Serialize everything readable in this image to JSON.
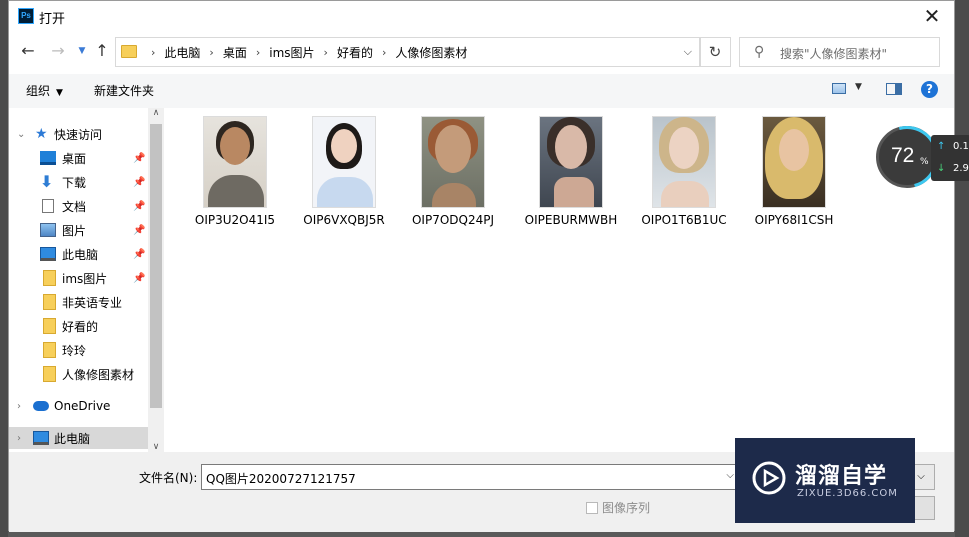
{
  "window": {
    "title": "打开",
    "app_icon": "Ps",
    "close": "✕"
  },
  "nav": {
    "crumbs": [
      "此电脑",
      "桌面",
      "ims图片",
      "好看的",
      "人像修图素材"
    ],
    "search_placeholder": "搜索\"人像修图素材\""
  },
  "toolbar": {
    "organize": "组织",
    "new_folder": "新建文件夹",
    "help": "?"
  },
  "sidebar": {
    "items": [
      {
        "label": "快速访问",
        "icon": "star-icon"
      },
      {
        "label": "桌面",
        "icon": "desktop-icon",
        "pinned": true
      },
      {
        "label": "下载",
        "icon": "download-icon",
        "pinned": true
      },
      {
        "label": "文档",
        "icon": "document-icon",
        "pinned": true
      },
      {
        "label": "图片",
        "icon": "pictures-icon",
        "pinned": true
      },
      {
        "label": "此电脑",
        "icon": "computer-icon",
        "pinned": true
      },
      {
        "label": "ims图片",
        "icon": "folder-icon",
        "pinned": true
      },
      {
        "label": "非英语专业",
        "icon": "folder-icon"
      },
      {
        "label": "好看的",
        "icon": "folder-icon"
      },
      {
        "label": "玲玲",
        "icon": "folder-icon"
      },
      {
        "label": "人像修图素材",
        "icon": "folder-icon"
      },
      {
        "label": "OneDrive",
        "icon": "cloud-icon"
      },
      {
        "label": "此电脑",
        "icon": "computer-icon",
        "selected": true
      }
    ]
  },
  "files": [
    {
      "name": "OIP3U2O41I5"
    },
    {
      "name": "OIP6VXQBJ5R"
    },
    {
      "name": "OIP7ODQ24PJ"
    },
    {
      "name": "OIPEBURMWBH"
    },
    {
      "name": "OIPO1T6B1UC"
    },
    {
      "name": "OIPY68I1CSH"
    }
  ],
  "bottom": {
    "filename_label": "文件名(N):",
    "filename_value": "QQ图片20200727121757",
    "image_sequence": "图像序列"
  },
  "watermark": {
    "title": "溜溜自学",
    "subtitle": "ZIXUE.3D66.COM"
  },
  "speed_widget": {
    "percent": "72",
    "percent_sign": "%",
    "upload": "0.1",
    "download": "2.9"
  }
}
